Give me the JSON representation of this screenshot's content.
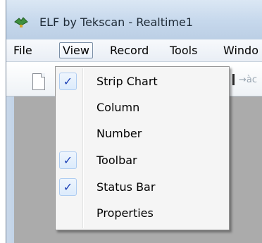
{
  "window": {
    "title": "ELF by Tekscan - Realtime1"
  },
  "menubar": {
    "items": [
      {
        "label": "File"
      },
      {
        "label": "View"
      },
      {
        "label": "Record"
      },
      {
        "label": "Tools"
      },
      {
        "label": "Windo"
      }
    ],
    "active": "View"
  },
  "toolbar": {
    "icons": [
      "new-document-icon",
      "cursor-icon",
      "zoom-icon"
    ],
    "zoom_glyph": "→àc"
  },
  "view_menu": {
    "items": [
      {
        "label": "Strip Chart",
        "checked": true,
        "check_glyph": "✓"
      },
      {
        "label": "Column",
        "checked": false
      },
      {
        "label": "Number",
        "checked": false
      },
      {
        "label": "Toolbar",
        "checked": true,
        "check_glyph": "✓"
      },
      {
        "label": "Status Bar",
        "checked": true,
        "check_glyph": "✓"
      },
      {
        "label": "Properties",
        "checked": false
      }
    ]
  },
  "colors": {
    "accent": "#1b3fb5",
    "client_background": "#ababab",
    "title_background": "#c6d8ec"
  }
}
